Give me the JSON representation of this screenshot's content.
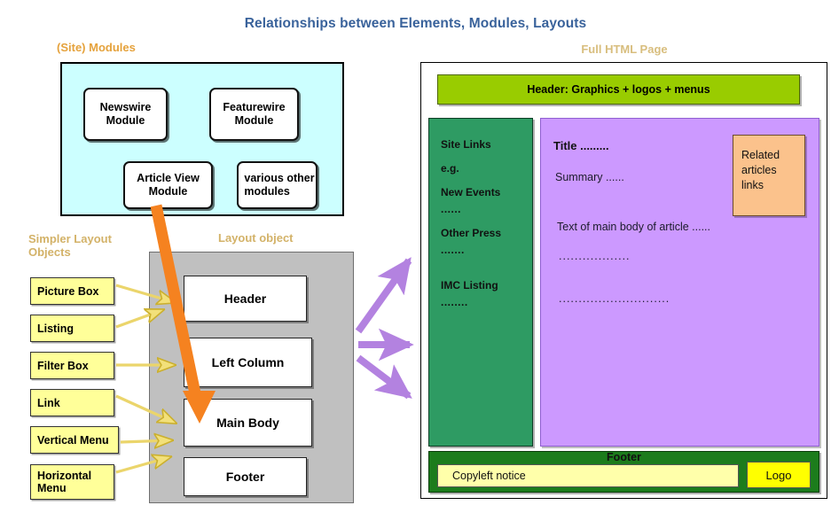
{
  "title": "Relationships between Elements, Modules, Layouts",
  "captions": {
    "modules": "(Site) Modules",
    "layout_object": "Layout object",
    "simpler_objects": "Simpler Layout\nObjects",
    "full_html_page": "Full HTML Page"
  },
  "modules": [
    {
      "id": "newswire",
      "label": "Newswire\nModule"
    },
    {
      "id": "featurewire",
      "label": "Featurewire\nModule"
    },
    {
      "id": "article-view",
      "label": "Article View\nModule"
    },
    {
      "id": "various-other",
      "label": "various other\nmodules"
    }
  ],
  "layout_boxes": [
    {
      "id": "header",
      "label": "Header"
    },
    {
      "id": "left-column",
      "label": "Left Column"
    },
    {
      "id": "main-body",
      "label": "Main Body"
    },
    {
      "id": "footer",
      "label": "Footer"
    }
  ],
  "simpler_objects": [
    {
      "id": "picture-box",
      "label": "Picture Box"
    },
    {
      "id": "listing",
      "label": "Listing"
    },
    {
      "id": "filter-box",
      "label": "Filter Box"
    },
    {
      "id": "link",
      "label": "Link"
    },
    {
      "id": "vertical-menu",
      "label": "Vertical Menu"
    },
    {
      "id": "horizontal-menu",
      "label": "Horizontal\nMenu"
    }
  ],
  "full_page": {
    "header_bar": "Header: Graphics + logos + menus",
    "site_links": [
      {
        "type": "heading",
        "text": "Site Links"
      },
      {
        "type": "heading",
        "text": "e.g."
      },
      {
        "type": "heading",
        "text": "New Events"
      },
      {
        "type": "dots",
        "text": "......"
      },
      {
        "type": "heading",
        "text": "Other Press"
      },
      {
        "type": "dots",
        "text": "......."
      },
      {
        "type": "heading",
        "text": "IMC Listing"
      },
      {
        "type": "dots",
        "text": "........"
      }
    ],
    "body": {
      "title": "Title .........",
      "summary": "Summary ......",
      "text": "Text of main body of article ......",
      "dots1": "..................",
      "dots2": "............................"
    },
    "related_box": "Related\narticles\nlinks",
    "footer": {
      "title": "Footer",
      "copyleft": "Copyleft notice",
      "logo": "Logo"
    }
  },
  "colors": {
    "title_blue": "#39629B",
    "caption_orange": "#E5A23C",
    "caption_tan": "#D3B268",
    "modules_panel_bg": "#CCFFFF",
    "layout_panel_bg": "#C0C0C0",
    "yellow_label_bg": "#FFFF99",
    "header_bar_green": "#99CC00",
    "site_links_green": "#2E9B63",
    "body_purple": "#CC99FF",
    "related_peach": "#FBC28C",
    "footer_green": "#1C7C1C",
    "copyleft_yellow": "#FFFFAA",
    "logo_yellow": "#FFFF00",
    "orange_arrow": "#F58220",
    "purple_arrow": "#B87FE0",
    "yellow_arrow": "#EFD24A"
  },
  "arrows": {
    "orange": "article-view-module-to-main-body",
    "purple": [
      "layout-to-page-top",
      "layout-to-page-middle",
      "layout-to-page-bottom"
    ],
    "yellow_count": 6
  }
}
